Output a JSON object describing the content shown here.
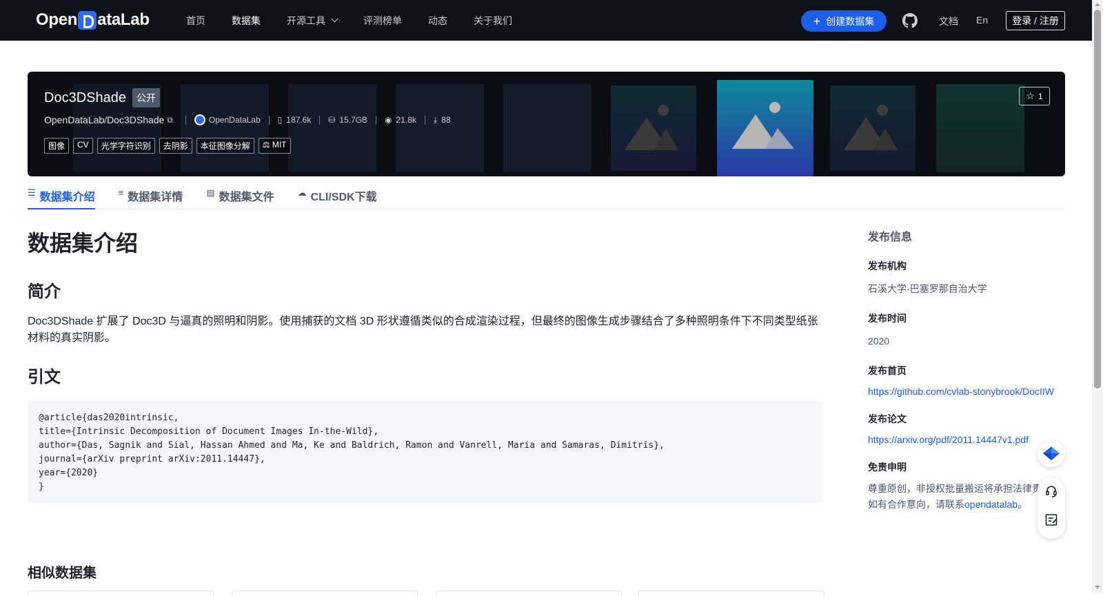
{
  "header": {
    "logo": "OpenDataLab",
    "nav": [
      {
        "label": "首页"
      },
      {
        "label": "数据集"
      },
      {
        "label": "开源工具"
      },
      {
        "label": "评测榜单"
      },
      {
        "label": "动态"
      },
      {
        "label": "关于我们"
      }
    ],
    "create_label": "创建数据集",
    "docs_label": "文档",
    "lang_label": "En",
    "login_label": "登录 / 注册"
  },
  "dataset": {
    "name": "Doc3DShade",
    "visibility": "公开",
    "repo": "OpenDataLab/Doc3DShade",
    "org": "OpenDataLab",
    "files": "187.6k",
    "size": "15.7GB",
    "views": "21.8k",
    "downloads": "88",
    "stars": "1",
    "tags": [
      "图像",
      "CV",
      "光学字符识别",
      "去阴影",
      "本征图像分解"
    ],
    "license": "MIT"
  },
  "tabs": [
    {
      "label": "数据集介绍",
      "icon": "database-icon"
    },
    {
      "label": "数据集详情",
      "icon": "list-icon"
    },
    {
      "label": "数据集文件",
      "icon": "file-icon"
    },
    {
      "label": "CLI/SDK下载",
      "icon": "cloud-download-icon"
    }
  ],
  "content": {
    "heading": "数据集介绍",
    "intro_heading": "简介",
    "intro_text": "Doc3DShade 扩展了 Doc3D 与逼真的照明和阴影。使用捕获的文档 3D 形状遵循类似的合成渲染过程，但最终的图像生成步骤结合了多种照明条件下不同类型纸张材料的真实阴影。",
    "citation_heading": "引文",
    "citation_lines": [
      "@article{das2020intrinsic,",
      "title={Intrinsic Decomposition of Document Images In-the-Wild},",
      "author={Das, Sagnik and Sial, Hassan Ahmed and Ma, Ke and Baldrich, Ramon and Vanrell, Maria and Samaras, Dimitris},",
      "journal={arXiv preprint arXiv:2011.14447},",
      "year={2020}",
      "}"
    ],
    "similar_heading": "相似数据集"
  },
  "sidebar": {
    "title": "发布信息",
    "org_label": "发布机构",
    "org_value": "石溪大学·巴塞罗那自治大学",
    "time_label": "发布时间",
    "time_value": "2020",
    "homepage_label": "发布首页",
    "homepage_value": "https://github.com/cvlab-stonybrook/DocIIW",
    "paper_label": "发布论文",
    "paper_value": "https://arxiv.org/pdf/2011.14447v1.pdf",
    "disclaimer_label": "免责申明",
    "disclaimer_line1": "尊重原创，非授权批量搬运将承担法律责",
    "disclaimer_line2_prefix": "如有合作意向，请联系",
    "disclaimer_link": "opendatalab",
    "disclaimer_line2_suffix": "。"
  },
  "colors": {
    "brand": "#1d5ee8",
    "header_bg": "#0e1117",
    "banner_bg": "#0b0d12"
  }
}
